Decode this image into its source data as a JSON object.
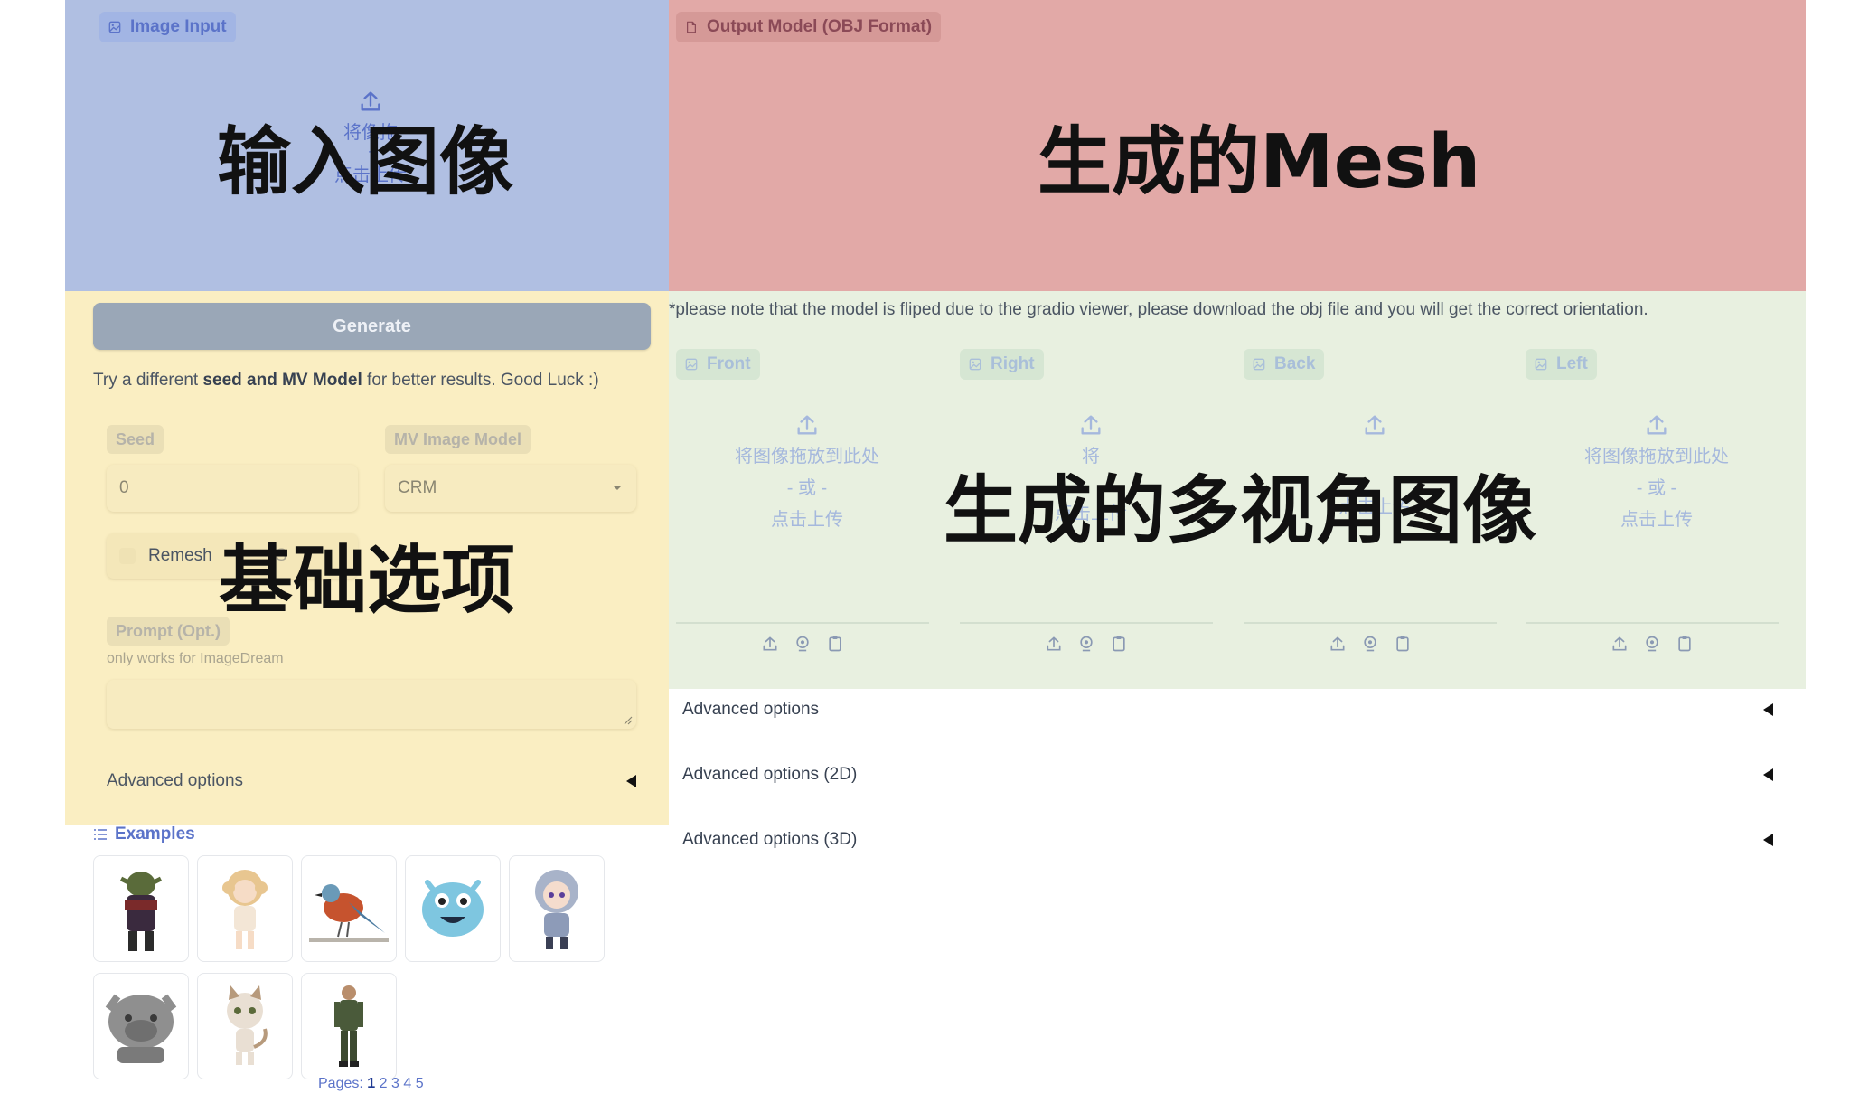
{
  "image_input": {
    "label": "Image Input",
    "upload_partial": "将像拖",
    "upload_partial_2": "此处",
    "upload_or": "-",
    "upload_click": "点击上传"
  },
  "output_model": {
    "label": "Output Model (OBJ Format)"
  },
  "overlays": {
    "input": "输入图像",
    "mesh": "生成的Mesh",
    "basic": "基础选项",
    "multiview": "生成的多视角图像"
  },
  "basic": {
    "generate_label": "Generate",
    "hint_prefix": "Try a different ",
    "hint_bold": "seed and MV Model",
    "hint_suffix": " for better results. Good Luck :)",
    "seed_label": "Seed",
    "seed_value": "0",
    "mv_model_label": "MV Image Model",
    "mv_model_value": "CRM",
    "remesh_label": "Remesh",
    "remesh_partial": "S",
    "prompt_label": "Prompt (Opt.)",
    "prompt_info": "only works for ImageDream",
    "prompt_value": "",
    "advanced_label": "Advanced options"
  },
  "note": "*please note that the model is fliped due to the gradio viewer, please download the obj file and you will get the correct orientation.",
  "multiview": {
    "views": [
      {
        "label": "Front",
        "line1": "将图像拖放到此处",
        "line2": "- 或 -",
        "line3": "点击上传"
      },
      {
        "label": "Right",
        "line1": "将",
        "line2": "",
        "line3": "点击上传"
      },
      {
        "label": "Back",
        "line1": "",
        "line2": "",
        "line3": "点击上传"
      },
      {
        "label": "Left",
        "line1": "将图像拖放到此处",
        "line2": "- 或 -",
        "line3": "点击上传"
      }
    ]
  },
  "accordions": [
    {
      "label": "Advanced options"
    },
    {
      "label": "Advanced options (2D)"
    },
    {
      "label": "Advanced options (3D)"
    }
  ],
  "examples": {
    "label": "Examples",
    "items": [
      "orc-warrior",
      "blonde-girl-figurine",
      "bird",
      "blue-fluffy-monster",
      "hooded-chibi",
      "stone-bulldog-bust",
      "cartoon-cat",
      "soldier"
    ],
    "pages_label": "Pages:",
    "pages": [
      "1",
      "2",
      "3",
      "4",
      "5"
    ]
  },
  "colors": {
    "input_region": "#b0bfe2",
    "mesh_region": "#e2a9a7",
    "basic_region": "#faeec2",
    "multiview_region": "#e8f0e0",
    "accent": "#5b73c9"
  },
  "icons": {
    "image": "image-icon",
    "file": "file-icon",
    "upload": "upload-icon",
    "webcam": "webcam-icon",
    "clipboard": "clipboard-icon",
    "dropdown": "chevron-down-icon",
    "list": "list-icon",
    "collapse": "triangle-left-icon"
  }
}
